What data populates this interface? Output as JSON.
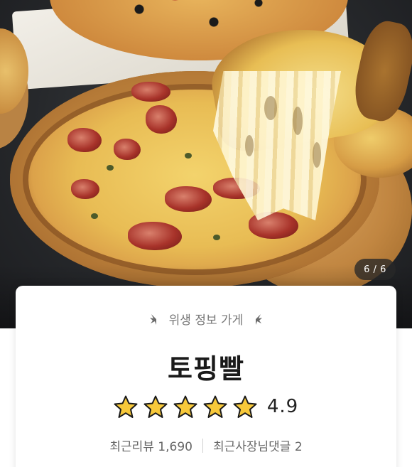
{
  "gallery": {
    "counter": "6 / 6",
    "photo_subject": "pizza-photo"
  },
  "store": {
    "badge": "위생 정보 가게",
    "name": "토핑빨",
    "rating": {
      "stars_filled": 5,
      "stars_total": 5,
      "value": "4.9"
    },
    "recent_reviews_label": "최근리뷰",
    "recent_reviews_count": "1,690",
    "recent_owner_replies_label": "최근사장님댓글",
    "recent_owner_replies_count": "2"
  },
  "colors": {
    "star": "#F8C93A",
    "star_outline": "#1a1a1a",
    "badge_text": "#777777",
    "counter_bg": "#282828"
  }
}
